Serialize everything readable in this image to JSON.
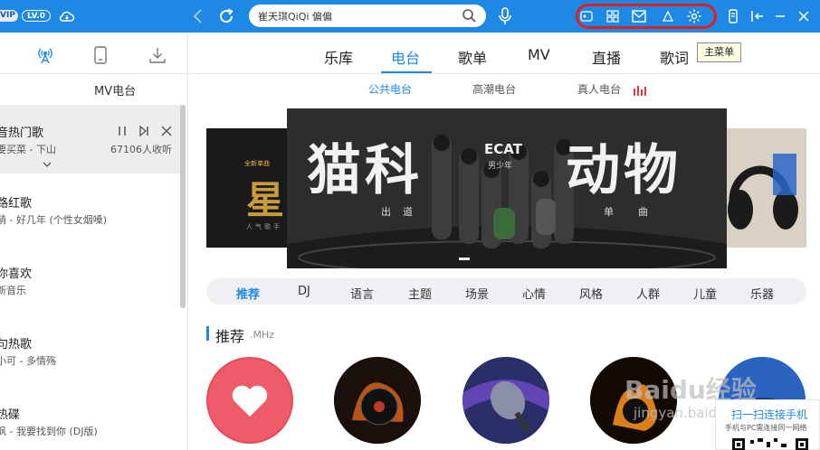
{
  "topbar": {
    "vip_label": "VIP",
    "level_label": "LV.0",
    "search_value": "崔天琪QiQi 偏偏",
    "accent": "#1e88e5"
  },
  "left_panel": {
    "tabs": [
      "",
      "MV电台"
    ],
    "items": [
      {
        "title": "音热门歌",
        "subtitle": "要买菜 - 下山",
        "listen_count": "67106人收听",
        "active": true
      },
      {
        "title": "路红歌",
        "subtitle": "萌 - 好几年 (个性女烟嗓)"
      },
      {
        "title": "你喜欢",
        "subtitle": "新音乐"
      },
      {
        "title": "句热歌",
        "subtitle": "小可 - 多情殇"
      },
      {
        "title": "热碟",
        "subtitle": "枫 - 我要找到你 (DJ版)"
      }
    ]
  },
  "main": {
    "nav_tabs": [
      "乐库",
      "电台",
      "歌单",
      "MV",
      "直播",
      "歌词"
    ],
    "active_nav": "电台",
    "tooltip": "主菜单",
    "sub_tabs": [
      "公共电台",
      "高潮电台",
      "真人电台"
    ],
    "banner": {
      "big_text_left": "猫科",
      "big_text_right": "动物",
      "logo": "ECAT",
      "logo_sub": "男少年",
      "tag_left": [
        "出",
        "道"
      ],
      "tag_right": [
        "单",
        "曲"
      ],
      "side_left_text": "星",
      "side_left_top": "全新单曲",
      "side_left_bottom": "人气歌手"
    },
    "categories": [
      "推荐",
      "DJ",
      "语言",
      "主题",
      "场景",
      "心情",
      "风格",
      "人群",
      "儿童",
      "乐器"
    ],
    "section_title": "推荐",
    "section_sub": ".MHz"
  },
  "qr": {
    "title": "扫一扫连接手机",
    "subtitle": "手机与PC需连接同一网络"
  },
  "watermark": {
    "main": "Baidu经验",
    "sub": "jingyan.baidu.com"
  }
}
